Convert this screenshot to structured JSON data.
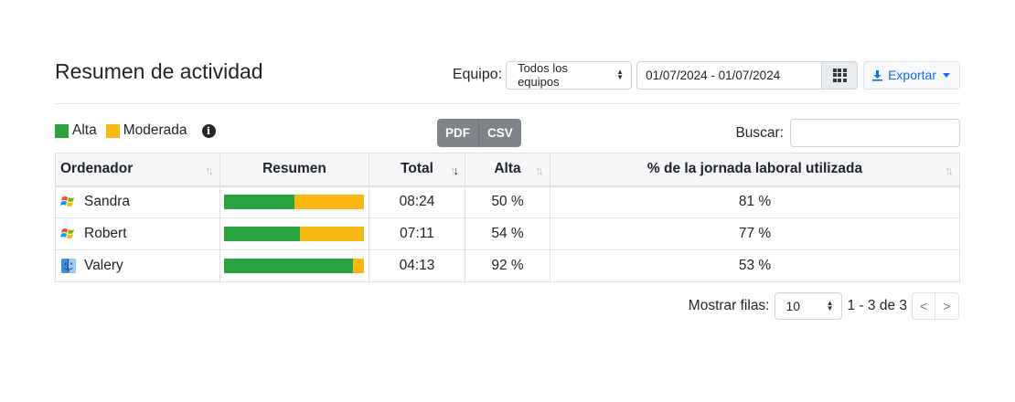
{
  "header": {
    "title": "Resumen de actividad",
    "team_label": "Equipo:",
    "team_value": "Todos los equipos",
    "date_range": "01/07/2024 - 01/07/2024",
    "export_label": "Exportar"
  },
  "toolbar": {
    "legend": [
      {
        "label": "Alta",
        "color": "#28a33d"
      },
      {
        "label": "Moderada",
        "color": "#fbb813"
      }
    ],
    "pdf_label": "PDF",
    "csv_label": "CSV",
    "search_label": "Buscar:",
    "search_value": ""
  },
  "table": {
    "columns": [
      "Ordenador",
      "Resumen",
      "Total",
      "Alta",
      "% de la jornada laboral utilizada"
    ],
    "rows": [
      {
        "name": "Sandra",
        "os_icon": "windows-icon",
        "alta_fraction": 0.5,
        "moderada_fraction": 0.5,
        "total": "08:24",
        "alta": "50 %",
        "jornada": "81 %"
      },
      {
        "name": "Robert",
        "os_icon": "windows-icon",
        "alta_fraction": 0.54,
        "moderada_fraction": 0.46,
        "total": "07:11",
        "alta": "54 %",
        "jornada": "77 %"
      },
      {
        "name": "Valery",
        "os_icon": "mac-finder-icon",
        "alta_fraction": 0.92,
        "moderada_fraction": 0.08,
        "total": "04:13",
        "alta": "92 %",
        "jornada": "53 %"
      }
    ]
  },
  "pager": {
    "rows_label": "Mostrar filas:",
    "rows_value": "10",
    "range_text": "1 - 3 de 3",
    "prev": "<",
    "next": ">"
  },
  "colors": {
    "alta": "#28a33d",
    "moderada": "#fbb813",
    "export": "#0d6efd"
  }
}
